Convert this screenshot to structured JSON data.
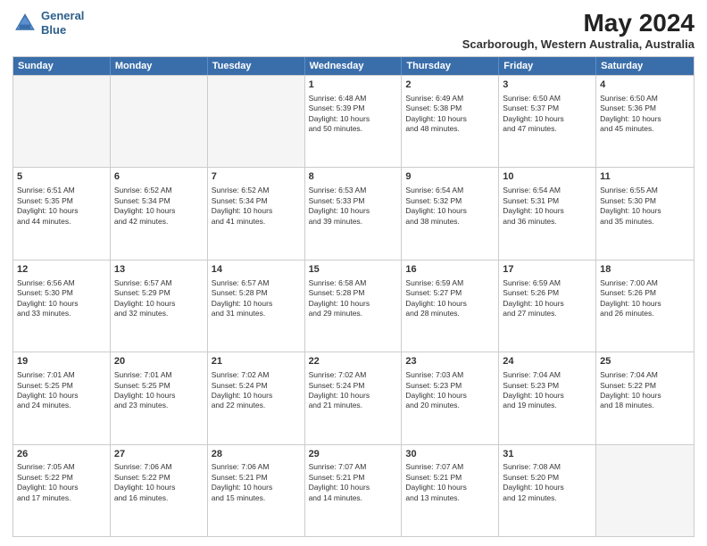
{
  "logo": {
    "line1": "General",
    "line2": "Blue"
  },
  "title": "May 2024",
  "subtitle": "Scarborough, Western Australia, Australia",
  "days": [
    "Sunday",
    "Monday",
    "Tuesday",
    "Wednesday",
    "Thursday",
    "Friday",
    "Saturday"
  ],
  "rows": [
    [
      {
        "day": "",
        "empty": true
      },
      {
        "day": "",
        "empty": true
      },
      {
        "day": "",
        "empty": true
      },
      {
        "day": "1",
        "lines": [
          "Sunrise: 6:48 AM",
          "Sunset: 5:39 PM",
          "Daylight: 10 hours",
          "and 50 minutes."
        ]
      },
      {
        "day": "2",
        "lines": [
          "Sunrise: 6:49 AM",
          "Sunset: 5:38 PM",
          "Daylight: 10 hours",
          "and 48 minutes."
        ]
      },
      {
        "day": "3",
        "lines": [
          "Sunrise: 6:50 AM",
          "Sunset: 5:37 PM",
          "Daylight: 10 hours",
          "and 47 minutes."
        ]
      },
      {
        "day": "4",
        "lines": [
          "Sunrise: 6:50 AM",
          "Sunset: 5:36 PM",
          "Daylight: 10 hours",
          "and 45 minutes."
        ]
      }
    ],
    [
      {
        "day": "5",
        "lines": [
          "Sunrise: 6:51 AM",
          "Sunset: 5:35 PM",
          "Daylight: 10 hours",
          "and 44 minutes."
        ]
      },
      {
        "day": "6",
        "lines": [
          "Sunrise: 6:52 AM",
          "Sunset: 5:34 PM",
          "Daylight: 10 hours",
          "and 42 minutes."
        ]
      },
      {
        "day": "7",
        "lines": [
          "Sunrise: 6:52 AM",
          "Sunset: 5:34 PM",
          "Daylight: 10 hours",
          "and 41 minutes."
        ]
      },
      {
        "day": "8",
        "lines": [
          "Sunrise: 6:53 AM",
          "Sunset: 5:33 PM",
          "Daylight: 10 hours",
          "and 39 minutes."
        ]
      },
      {
        "day": "9",
        "lines": [
          "Sunrise: 6:54 AM",
          "Sunset: 5:32 PM",
          "Daylight: 10 hours",
          "and 38 minutes."
        ]
      },
      {
        "day": "10",
        "lines": [
          "Sunrise: 6:54 AM",
          "Sunset: 5:31 PM",
          "Daylight: 10 hours",
          "and 36 minutes."
        ]
      },
      {
        "day": "11",
        "lines": [
          "Sunrise: 6:55 AM",
          "Sunset: 5:30 PM",
          "Daylight: 10 hours",
          "and 35 minutes."
        ]
      }
    ],
    [
      {
        "day": "12",
        "lines": [
          "Sunrise: 6:56 AM",
          "Sunset: 5:30 PM",
          "Daylight: 10 hours",
          "and 33 minutes."
        ]
      },
      {
        "day": "13",
        "lines": [
          "Sunrise: 6:57 AM",
          "Sunset: 5:29 PM",
          "Daylight: 10 hours",
          "and 32 minutes."
        ]
      },
      {
        "day": "14",
        "lines": [
          "Sunrise: 6:57 AM",
          "Sunset: 5:28 PM",
          "Daylight: 10 hours",
          "and 31 minutes."
        ]
      },
      {
        "day": "15",
        "lines": [
          "Sunrise: 6:58 AM",
          "Sunset: 5:28 PM",
          "Daylight: 10 hours",
          "and 29 minutes."
        ]
      },
      {
        "day": "16",
        "lines": [
          "Sunrise: 6:59 AM",
          "Sunset: 5:27 PM",
          "Daylight: 10 hours",
          "and 28 minutes."
        ]
      },
      {
        "day": "17",
        "lines": [
          "Sunrise: 6:59 AM",
          "Sunset: 5:26 PM",
          "Daylight: 10 hours",
          "and 27 minutes."
        ]
      },
      {
        "day": "18",
        "lines": [
          "Sunrise: 7:00 AM",
          "Sunset: 5:26 PM",
          "Daylight: 10 hours",
          "and 26 minutes."
        ]
      }
    ],
    [
      {
        "day": "19",
        "lines": [
          "Sunrise: 7:01 AM",
          "Sunset: 5:25 PM",
          "Daylight: 10 hours",
          "and 24 minutes."
        ]
      },
      {
        "day": "20",
        "lines": [
          "Sunrise: 7:01 AM",
          "Sunset: 5:25 PM",
          "Daylight: 10 hours",
          "and 23 minutes."
        ]
      },
      {
        "day": "21",
        "lines": [
          "Sunrise: 7:02 AM",
          "Sunset: 5:24 PM",
          "Daylight: 10 hours",
          "and 22 minutes."
        ]
      },
      {
        "day": "22",
        "lines": [
          "Sunrise: 7:02 AM",
          "Sunset: 5:24 PM",
          "Daylight: 10 hours",
          "and 21 minutes."
        ]
      },
      {
        "day": "23",
        "lines": [
          "Sunrise: 7:03 AM",
          "Sunset: 5:23 PM",
          "Daylight: 10 hours",
          "and 20 minutes."
        ]
      },
      {
        "day": "24",
        "lines": [
          "Sunrise: 7:04 AM",
          "Sunset: 5:23 PM",
          "Daylight: 10 hours",
          "and 19 minutes."
        ]
      },
      {
        "day": "25",
        "lines": [
          "Sunrise: 7:04 AM",
          "Sunset: 5:22 PM",
          "Daylight: 10 hours",
          "and 18 minutes."
        ]
      }
    ],
    [
      {
        "day": "26",
        "lines": [
          "Sunrise: 7:05 AM",
          "Sunset: 5:22 PM",
          "Daylight: 10 hours",
          "and 17 minutes."
        ]
      },
      {
        "day": "27",
        "lines": [
          "Sunrise: 7:06 AM",
          "Sunset: 5:22 PM",
          "Daylight: 10 hours",
          "and 16 minutes."
        ]
      },
      {
        "day": "28",
        "lines": [
          "Sunrise: 7:06 AM",
          "Sunset: 5:21 PM",
          "Daylight: 10 hours",
          "and 15 minutes."
        ]
      },
      {
        "day": "29",
        "lines": [
          "Sunrise: 7:07 AM",
          "Sunset: 5:21 PM",
          "Daylight: 10 hours",
          "and 14 minutes."
        ]
      },
      {
        "day": "30",
        "lines": [
          "Sunrise: 7:07 AM",
          "Sunset: 5:21 PM",
          "Daylight: 10 hours",
          "and 13 minutes."
        ]
      },
      {
        "day": "31",
        "lines": [
          "Sunrise: 7:08 AM",
          "Sunset: 5:20 PM",
          "Daylight: 10 hours",
          "and 12 minutes."
        ]
      },
      {
        "day": "",
        "empty": true
      }
    ]
  ]
}
